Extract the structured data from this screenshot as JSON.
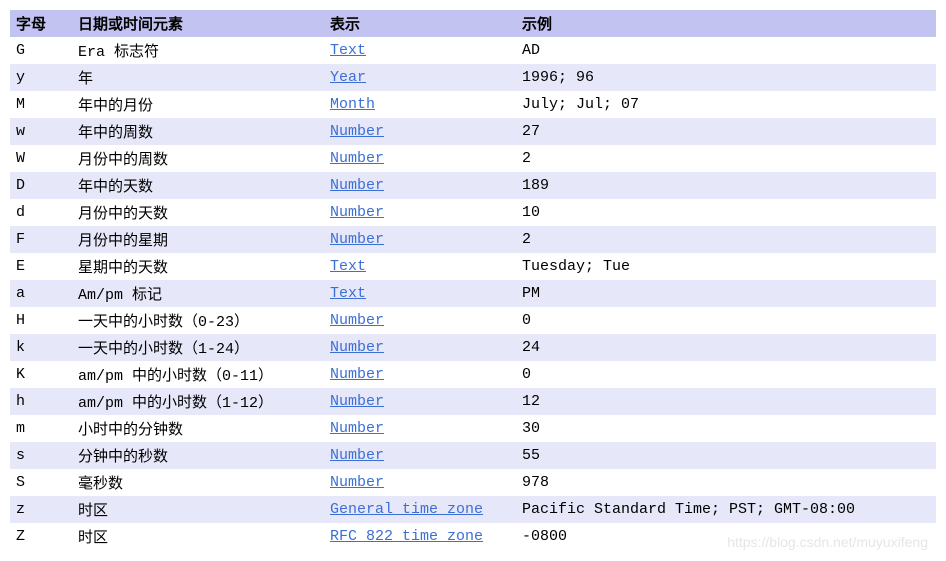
{
  "headers": {
    "letter": "字母",
    "component": "日期或时间元素",
    "presentation": "表示",
    "example": "示例"
  },
  "rows": [
    {
      "letter": "G",
      "component": "Era 标志符",
      "presentation": "Text",
      "example": "AD"
    },
    {
      "letter": "y",
      "component": "年",
      "presentation": "Year",
      "example": "1996; 96"
    },
    {
      "letter": "M",
      "component": "年中的月份",
      "presentation": "Month",
      "example": "July; Jul; 07"
    },
    {
      "letter": "w",
      "component": "年中的周数",
      "presentation": "Number",
      "example": "27"
    },
    {
      "letter": "W",
      "component": "月份中的周数",
      "presentation": "Number",
      "example": "2"
    },
    {
      "letter": "D",
      "component": "年中的天数",
      "presentation": "Number",
      "example": "189"
    },
    {
      "letter": "d",
      "component": "月份中的天数",
      "presentation": "Number",
      "example": "10"
    },
    {
      "letter": "F",
      "component": "月份中的星期",
      "presentation": "Number",
      "example": "2"
    },
    {
      "letter": "E",
      "component": "星期中的天数",
      "presentation": "Text",
      "example": "Tuesday; Tue"
    },
    {
      "letter": "a",
      "component": "Am/pm 标记",
      "presentation": "Text",
      "example": "PM"
    },
    {
      "letter": "H",
      "component": "一天中的小时数（0-23）",
      "presentation": "Number",
      "example": "0"
    },
    {
      "letter": "k",
      "component": "一天中的小时数（1-24）",
      "presentation": "Number",
      "example": "24"
    },
    {
      "letter": "K",
      "component": "am/pm 中的小时数（0-11）",
      "presentation": "Number",
      "example": "0"
    },
    {
      "letter": "h",
      "component": "am/pm 中的小时数（1-12）",
      "presentation": "Number",
      "example": "12"
    },
    {
      "letter": "m",
      "component": "小时中的分钟数",
      "presentation": "Number",
      "example": "30"
    },
    {
      "letter": "s",
      "component": "分钟中的秒数",
      "presentation": "Number",
      "example": "55"
    },
    {
      "letter": "S",
      "component": "毫秒数",
      "presentation": "Number",
      "example": "978"
    },
    {
      "letter": "z",
      "component": "时区",
      "presentation": "General time zone",
      "example": "Pacific Standard Time; PST; GMT-08:00"
    },
    {
      "letter": "Z",
      "component": "时区",
      "presentation": "RFC 822 time zone",
      "example": "-0800"
    }
  ],
  "watermark": "https://blog.csdn.net/muyuxifeng"
}
